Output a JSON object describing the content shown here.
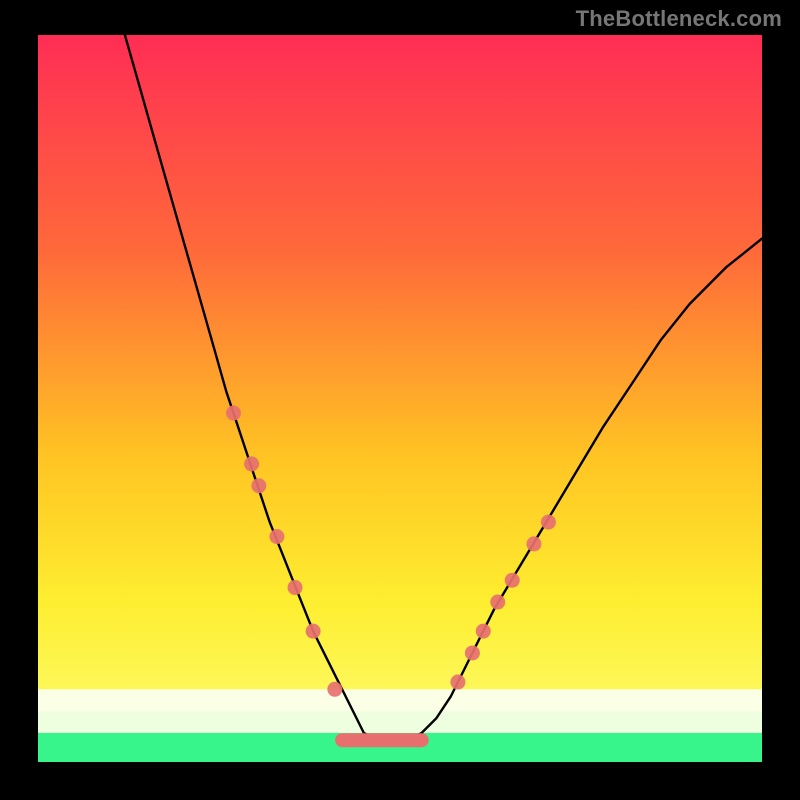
{
  "watermark": "TheBottleneck.com",
  "colors": {
    "bg": "#000000",
    "watermark": "#767676",
    "curve": "#000000",
    "marker_fill": "#e7706f",
    "green_band": "#37f58b",
    "pale_band_top": "#fbffe5",
    "pale_band_bottom": "#eeffe0",
    "gradient_top": "#ff2d55",
    "gradient_mid_a": "#ff6a3a",
    "gradient_mid_b": "#ffc423",
    "gradient_mid_c": "#feee30",
    "gradient_bottom": "#fcff7a"
  },
  "chart_data": {
    "type": "line",
    "title": "",
    "xlabel": "",
    "ylabel": "",
    "xlim": [
      0,
      100
    ],
    "ylim": [
      0,
      100
    ],
    "series": [
      {
        "name": "bottleneck-curve",
        "x": [
          12,
          14,
          16,
          18,
          20,
          22,
          24,
          26,
          28,
          30,
          32,
          34,
          36,
          38,
          40,
          42,
          44,
          45,
          47,
          49,
          51,
          53,
          55,
          57,
          59,
          61,
          63,
          66,
          69,
          72,
          75,
          78,
          82,
          86,
          90,
          95,
          100
        ],
        "values": [
          100,
          93,
          86,
          79,
          72,
          65,
          58,
          51,
          45,
          39,
          33,
          28,
          23,
          18,
          14,
          10,
          6,
          4,
          3,
          3,
          3,
          4,
          6,
          9,
          13,
          17,
          21,
          26,
          31,
          36,
          41,
          46,
          52,
          58,
          63,
          68,
          72
        ]
      }
    ],
    "markers_left": {
      "x": [
        27,
        29.5,
        30.5,
        33,
        35.5,
        38,
        41
      ],
      "values": [
        48,
        41,
        38,
        31,
        24,
        18,
        10
      ]
    },
    "markers_right": {
      "x": [
        58,
        60,
        61.5,
        63.5,
        65.5,
        68.5,
        70.5
      ],
      "values": [
        11,
        15,
        18,
        22,
        25,
        30,
        33
      ]
    },
    "valley_band": {
      "x_start": 42,
      "x_end": 53,
      "y": 3
    },
    "green_band_y": [
      0,
      4
    ],
    "pale_band_y": [
      4,
      10
    ]
  }
}
